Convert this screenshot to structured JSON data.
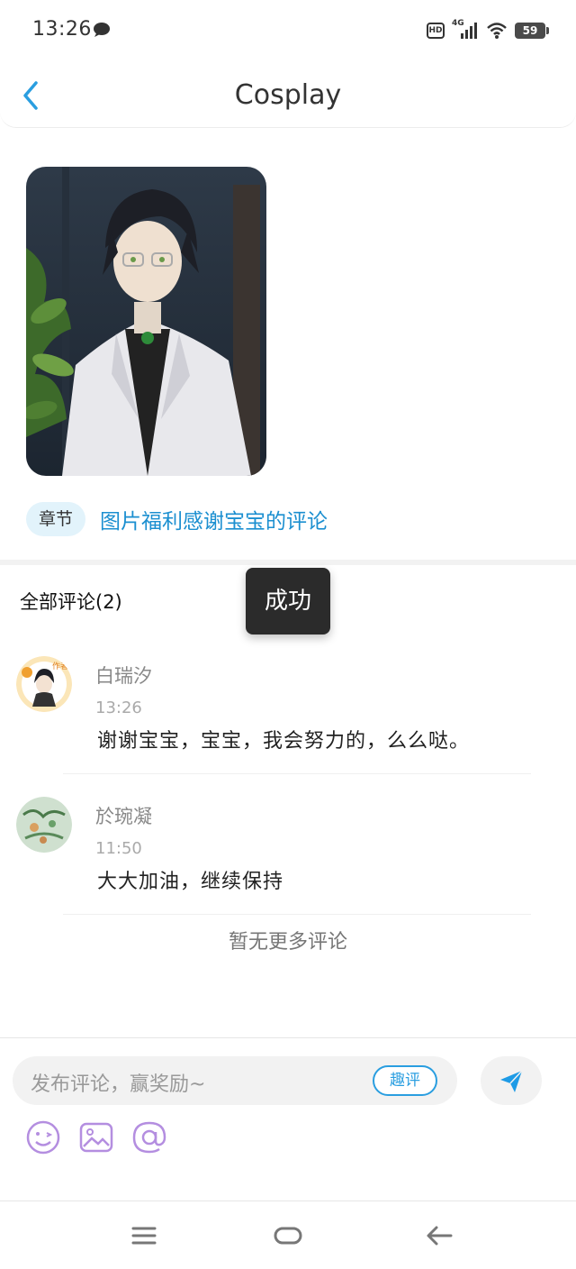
{
  "status_bar": {
    "time": "13:26",
    "network": "4G",
    "battery": "59",
    "hd_label": "HD"
  },
  "header": {
    "title": "Cosplay"
  },
  "chapter": {
    "tag": "章节",
    "title": "图片福利感谢宝宝的评论"
  },
  "comments": {
    "title": "全部评论(2)",
    "items": [
      {
        "name": "白瑞汐",
        "time": "13:26",
        "text": "谢谢宝宝，宝宝，我会努力的，么么哒。"
      },
      {
        "name": "於琬凝",
        "time": "11:50",
        "text": "大大加油，继续保持"
      }
    ],
    "no_more": "暂无更多评论"
  },
  "toast": {
    "text": "成功"
  },
  "input": {
    "placeholder": "发布评论，赢奖励~",
    "quping_label": "趣评"
  },
  "colors": {
    "accent": "#1b8fd0",
    "tag_bg": "#e2f3fb",
    "tool_purple": "#b48ee0",
    "send_blue": "#1e9be6"
  },
  "icons": [
    "back-arrow-icon",
    "send-icon",
    "emoji-icon",
    "image-icon",
    "at-icon",
    "menu-icon",
    "home-icon",
    "back-icon"
  ]
}
